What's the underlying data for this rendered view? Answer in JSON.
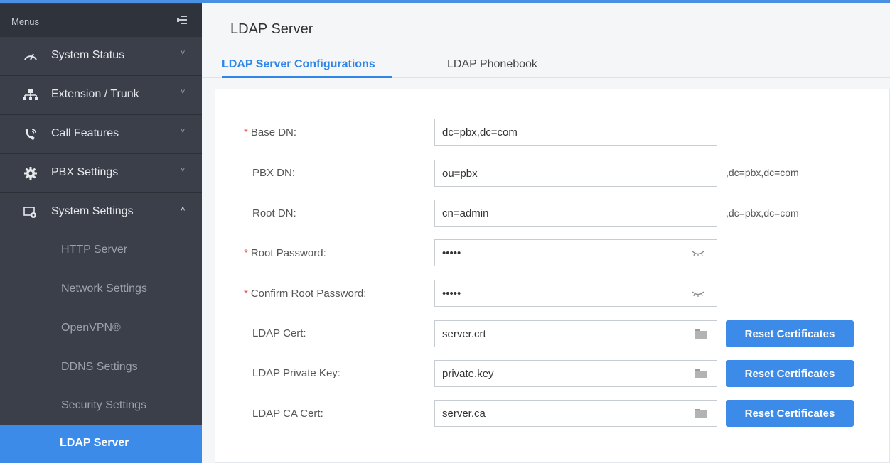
{
  "sidebar": {
    "header": "Menus",
    "items": [
      {
        "label": "System Status",
        "icon": "gauge-icon",
        "chevron": "˅"
      },
      {
        "label": "Extension / Trunk",
        "icon": "network-icon",
        "chevron": "˅"
      },
      {
        "label": "Call Features",
        "icon": "phone-icon",
        "chevron": "˅"
      },
      {
        "label": "PBX Settings",
        "icon": "gear-icon",
        "chevron": "˅"
      },
      {
        "label": "System Settings",
        "icon": "settings-window-icon",
        "chevron": "˄"
      }
    ],
    "subitems": [
      {
        "label": "HTTP Server"
      },
      {
        "label": "Network Settings"
      },
      {
        "label": "OpenVPN®"
      },
      {
        "label": "DDNS Settings"
      },
      {
        "label": "Security Settings"
      },
      {
        "label": "LDAP Server",
        "active": true
      }
    ]
  },
  "main": {
    "title": "LDAP Server",
    "tabs": [
      {
        "label": "LDAP Server Configurations",
        "active": true
      },
      {
        "label": "LDAP Phonebook"
      }
    ],
    "form": {
      "base_dn": {
        "label": "Base DN",
        "value": "dc=pbx,dc=com",
        "required": "*"
      },
      "pbx_dn": {
        "label": "PBX DN",
        "value": "ou=pbx",
        "suffix": ",dc=pbx,dc=com"
      },
      "root_dn": {
        "label": "Root DN",
        "value": "cn=admin",
        "suffix": ",dc=pbx,dc=com"
      },
      "root_password": {
        "label": "Root Password",
        "value": "•••••",
        "required": "*"
      },
      "confirm_root_password": {
        "label": "Confirm Root Password",
        "value": "•••••",
        "required": "*"
      },
      "ldap_cert": {
        "label": "LDAP Cert",
        "value": "server.crt"
      },
      "ldap_private_key": {
        "label": "LDAP Private Key",
        "value": "private.key"
      },
      "ldap_ca_cert": {
        "label": "LDAP CA Cert",
        "value": "server.ca"
      },
      "colon": ":",
      "reset_label": "Reset Certificates"
    }
  },
  "colors": {
    "accent": "#3d8be8",
    "sidebar_bg": "#3b3f49",
    "required": "#e45a5a"
  }
}
